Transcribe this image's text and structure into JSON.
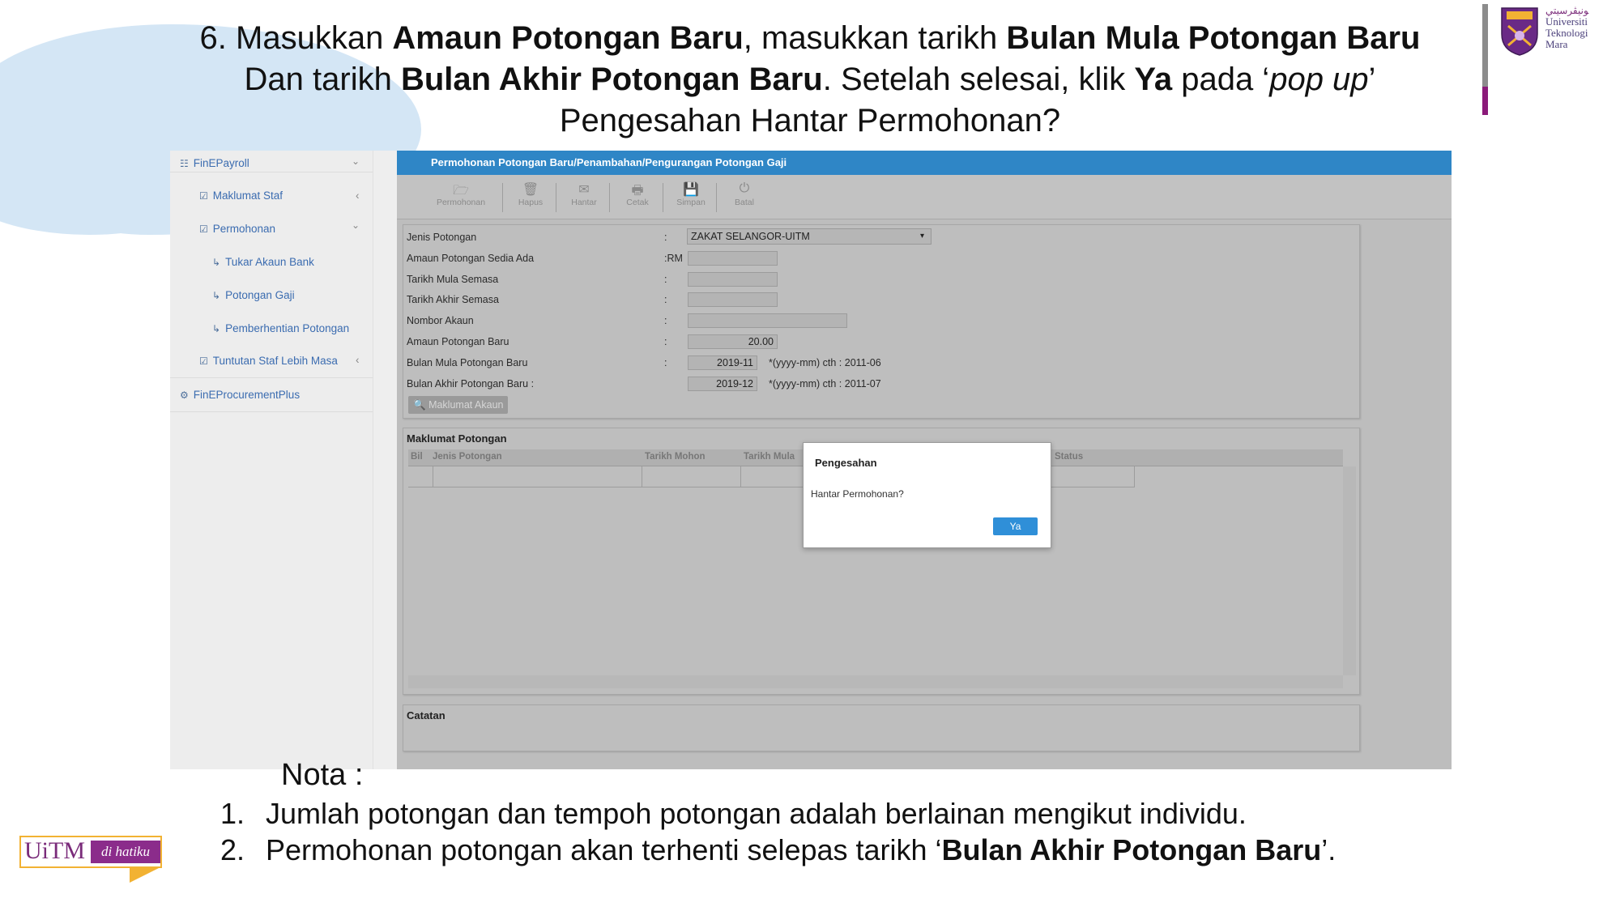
{
  "heading": {
    "line1_pre": "6. Masukkan ",
    "line1_b1": "Amaun Potongan Baru",
    "line1_mid": ", masukkan tarikh ",
    "line1_b2": "Bulan Mula Potongan Baru",
    "line2_pre": "Dan tarikh ",
    "line2_b1": "Bulan Akhir Potongan Baru",
    "line2_mid": ". Setelah selesai, klik ",
    "line2_b2": "Ya",
    "line2_mid2": " pada ‘",
    "line2_i": "pop up",
    "line2_end": "’",
    "line3": "Pengesahan Hantar Permohonan?"
  },
  "logo": {
    "jawi": "ﻮﻧﻴﭭﺮﺳﻴﺘﻲ",
    "line1": "Universiti",
    "line2": "Teknologi",
    "line3": "Mara"
  },
  "sidebar": {
    "items": [
      {
        "label": "FinEPayroll",
        "icon": "sitemap-icon"
      },
      {
        "label": "Maklumat Staf",
        "icon": "check-square-icon"
      },
      {
        "label": "Permohonan",
        "icon": "check-square-icon"
      },
      {
        "label": "Tukar Akaun Bank",
        "icon": "sub-arrow-icon"
      },
      {
        "label": "Potongan Gaji",
        "icon": "sub-arrow-icon"
      },
      {
        "label": "Pemberhentian Potongan",
        "icon": "sub-arrow-icon"
      },
      {
        "label": "Tuntutan Staf Lebih Masa",
        "icon": "check-square-icon"
      },
      {
        "label": "FinEProcurementPlus",
        "icon": "users-icon"
      }
    ]
  },
  "window": {
    "title": "Permohonan Potongan Baru/Penambahan/Pengurangan Potongan Gaji"
  },
  "toolbar": {
    "buttons": [
      "Permohonan",
      "Hapus",
      "Hantar",
      "Cetak",
      "Simpan",
      "Batal"
    ]
  },
  "form": {
    "fields": [
      {
        "label": "Jenis Potongan",
        "colon": ":",
        "value": "ZAKAT SELANGOR-UITM"
      },
      {
        "label": "Amaun Potongan Sedia Ada",
        "colon": ":RM",
        "value": ""
      },
      {
        "label": "Tarikh Mula Semasa",
        "colon": ":",
        "value": ""
      },
      {
        "label": "Tarikh Akhir Semasa",
        "colon": ":",
        "value": ""
      },
      {
        "label": "Nombor Akaun",
        "colon": ":",
        "value": ""
      },
      {
        "label": "Amaun Potongan Baru",
        "colon": ":",
        "value": "20.00"
      },
      {
        "label": "Bulan Mula Potongan Baru",
        "colon": ":",
        "value": "2019-11",
        "hint": "*(yyyy-mm) cth : 2011-06"
      },
      {
        "label": "Bulan Akhir Potongan Baru :",
        "colon": "",
        "value": "2019-12",
        "hint": "*(yyyy-mm) cth : 2011-07"
      }
    ],
    "akaun_button": "Maklumat Akaun"
  },
  "grid": {
    "title": "Maklumat Potongan",
    "columns": [
      "Bil",
      "Jenis Potongan",
      "Tarikh Mohon",
      "Tarikh Mula",
      "Status"
    ]
  },
  "catatan": {
    "title": "Catatan"
  },
  "dialog": {
    "title": "Pengesahan",
    "message": "Hantar Permohonan?",
    "button": "Ya"
  },
  "notes": {
    "title": "Nota :",
    "items": [
      {
        "num": "1.",
        "text": "Jumlah potongan dan tempoh potongan adalah berlainan mengikut individu."
      },
      {
        "num": "2.",
        "pre": "Permohonan potongan akan terhenti selepas tarikh ‘",
        "bold": "Bulan Akhir Potongan Baru",
        "post": "’."
      }
    ]
  },
  "badge": {
    "brand": "UiTM",
    "tagline": "di hatiku"
  },
  "colors": {
    "accent": "#2f86c6",
    "button": "#2f8fd8",
    "brand_purple": "#8b2c8b",
    "brand_gold": "#f2b233"
  }
}
